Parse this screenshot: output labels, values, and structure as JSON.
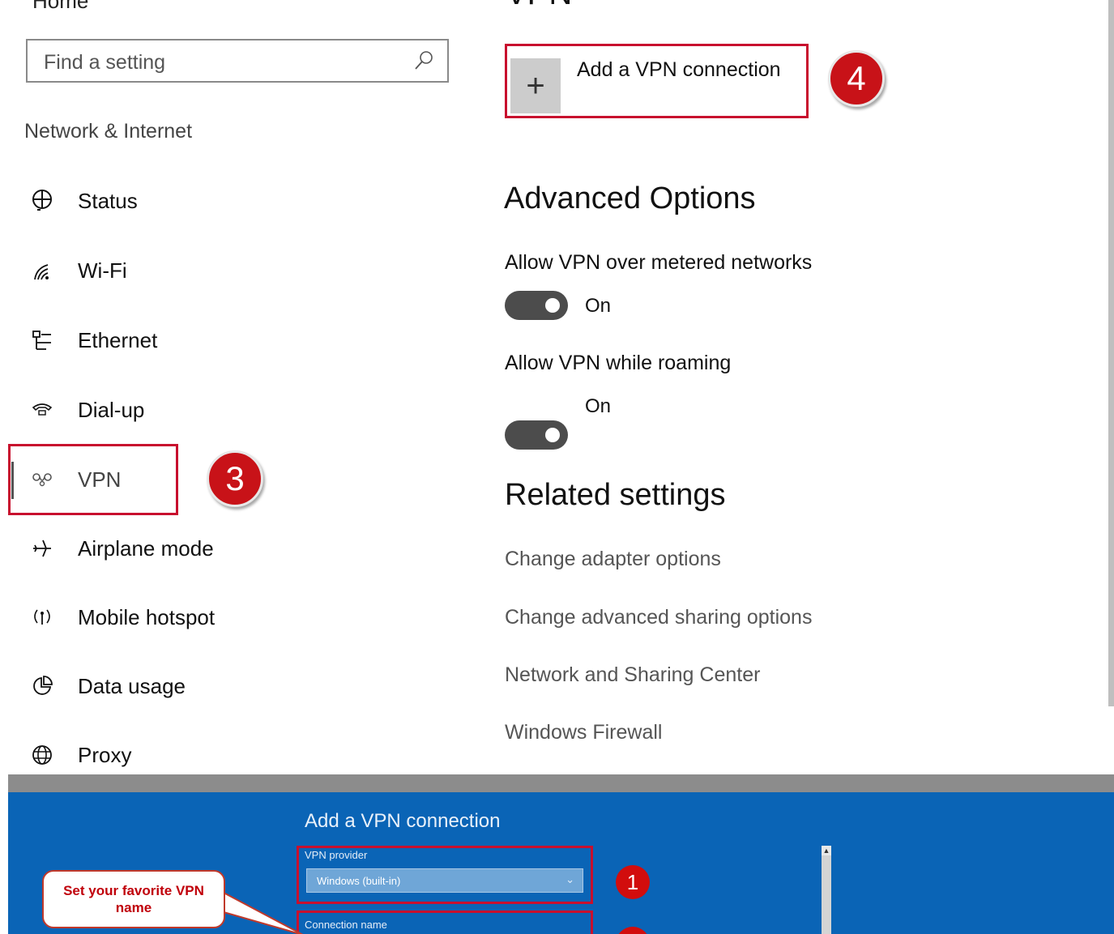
{
  "sidebar": {
    "home_label": "Home",
    "search_placeholder": "Find a setting",
    "section_title": "Network & Internet",
    "items": [
      {
        "label": "Status",
        "icon": "globe-icon"
      },
      {
        "label": "Wi-Fi",
        "icon": "wifi-icon"
      },
      {
        "label": "Ethernet",
        "icon": "ethernet-icon"
      },
      {
        "label": "Dial-up",
        "icon": "phone-icon"
      },
      {
        "label": "VPN",
        "icon": "vpn-icon",
        "active": true
      },
      {
        "label": "Airplane mode",
        "icon": "airplane-icon"
      },
      {
        "label": "Mobile hotspot",
        "icon": "hotspot-icon"
      },
      {
        "label": "Data usage",
        "icon": "data-usage-icon"
      },
      {
        "label": "Proxy",
        "icon": "globe-icon"
      }
    ]
  },
  "main": {
    "page_title": "VPN",
    "add_vpn_label": "Add a VPN connection",
    "advanced_heading": "Advanced Options",
    "options": [
      {
        "label": "Allow VPN over metered networks",
        "state": "On"
      },
      {
        "label": "Allow VPN while roaming",
        "state": "On"
      }
    ],
    "related_heading": "Related settings",
    "related_links": [
      "Change adapter options",
      "Change advanced sharing options",
      "Network and Sharing Center",
      "Windows Firewall"
    ]
  },
  "annotations": {
    "step3": "3",
    "step4": "4",
    "step1": "1",
    "callout": "Set your favorite VPN name"
  },
  "dialog": {
    "title": "Add a VPN connection",
    "provider_label": "VPN provider",
    "provider_value": "Windows (built-in)",
    "connection_name_label": "Connection name"
  },
  "colors": {
    "highlight_red": "#c8102e",
    "badge_red": "#c81218",
    "panel_blue": "#0a64b6",
    "toggle_on": "#4c4c4c"
  }
}
